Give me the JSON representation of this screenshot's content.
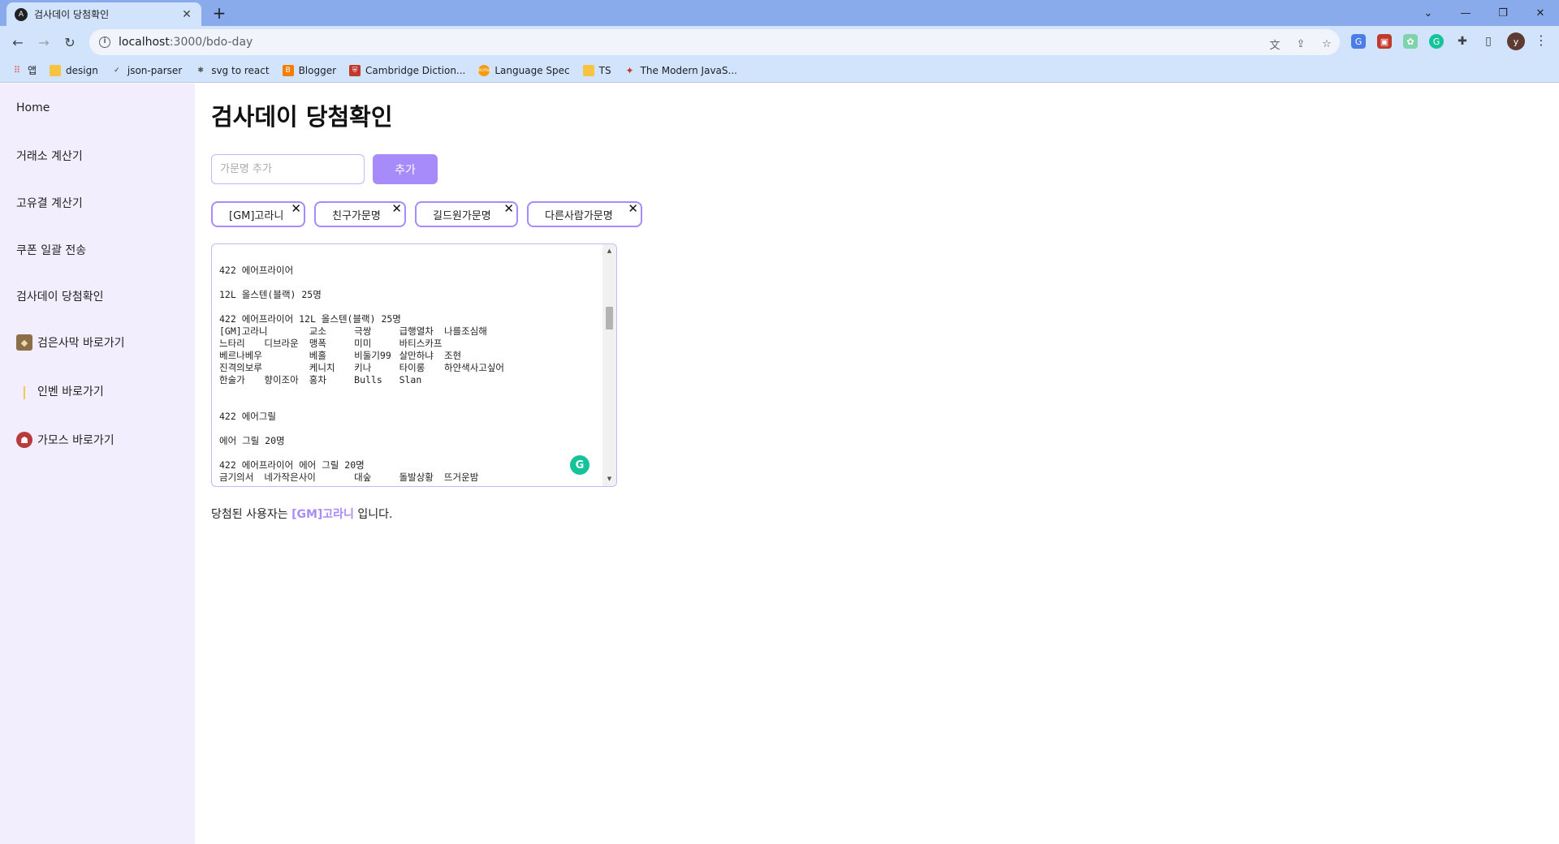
{
  "browser": {
    "tab_title": "검사데이 당첨확인",
    "tab_favicon": "A",
    "new_tab": "+",
    "url_host": "localhost",
    "url_path": ":3000/bdo-day",
    "profile_initial": "y",
    "bookmarks": [
      {
        "label": "앱",
        "icon": "apps-grid-icon"
      },
      {
        "label": "design",
        "icon": "folder-icon"
      },
      {
        "label": "json-parser",
        "icon": "json-icon"
      },
      {
        "label": "svg to react",
        "icon": "svg-icon"
      },
      {
        "label": "Blogger",
        "icon": "blogger-icon"
      },
      {
        "label": "Cambridge Diction...",
        "icon": "cambridge-icon"
      },
      {
        "label": "Language Spec",
        "icon": "ecma-icon"
      },
      {
        "label": "TS",
        "icon": "folder-icon"
      },
      {
        "label": "The Modern JavaS...",
        "icon": "modern-js-icon"
      }
    ],
    "colors": {
      "tabstrip": "#8aabeb",
      "toolbar": "#d2e3fc"
    }
  },
  "sidebar": {
    "items": [
      {
        "label": "Home",
        "icon": ""
      },
      {
        "label": "거래소 계산기",
        "icon": ""
      },
      {
        "label": "고유결 계산기",
        "icon": ""
      },
      {
        "label": "쿠폰 일괄 전송",
        "icon": ""
      },
      {
        "label": "검사데이 당첨확인",
        "icon": ""
      },
      {
        "label": "검은사막 바로가기",
        "icon": "black-desert-icon"
      },
      {
        "label": "인벤 바로가기",
        "icon": "inven-icon"
      },
      {
        "label": "가모스 바로가기",
        "icon": "garmoth-icon"
      }
    ]
  },
  "main": {
    "title": "검사데이 당첨확인",
    "input_placeholder": "가문명 추가",
    "add_button": "추가",
    "chips": [
      "[GM]고라니",
      "친구가문명",
      "길드원가문명",
      "다른사람가문명"
    ],
    "textarea_text": "\n422 에어프라이어\n\n12L 올스텐(블랙) 25명\n\n422 에어프라이어 12L 올스텐(블랙) 25명\n[GM]고라니\t교소\t극쌍\t급행열차\t나를조심해\n느타리\t디브라운\t맹폭\t미미\t바티스카프\n베르나베우\t베홀\t비둘기99\t살만하냐\t조현\n진격의보루\t케니치\t키나\t타이롱\t하얀색사고싶어\n한술가\t향이조아\t홍차\tBulls\tSlan\n\n\n422 에어그릴\n\n에어 그릴 20명\n\n422 에어프라이어 에어 그릴 20명\n금기의서\t네가작은사이\t대숲\t돌발상황\t뜨거운밤",
    "result_prefix": "당첨된 사용자는 ",
    "result_winner": "[GM]고라니",
    "result_suffix": " 입니다.",
    "accent_color": "#a78bfa"
  }
}
